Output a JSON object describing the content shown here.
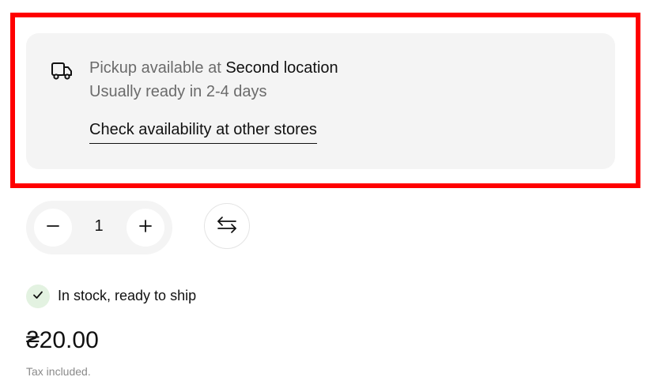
{
  "pickup": {
    "prefix": "Pickup available at ",
    "location": "Second location",
    "ready_text": "Usually ready in 2-4 days",
    "check_link": "Check availability at other stores"
  },
  "quantity": {
    "value": "1",
    "decrease_icon": "minus-icon",
    "increase_icon": "plus-icon"
  },
  "compare_icon": "swap-arrows-icon",
  "stock": {
    "text": "In stock, ready to ship",
    "icon": "checkmark-icon",
    "badge_color": "#e3f2e1"
  },
  "price": {
    "amount": "₴20.00",
    "tax_note": "Tax included."
  },
  "colors": {
    "highlight": "#ff0000",
    "card_bg": "#f4f4f4"
  }
}
